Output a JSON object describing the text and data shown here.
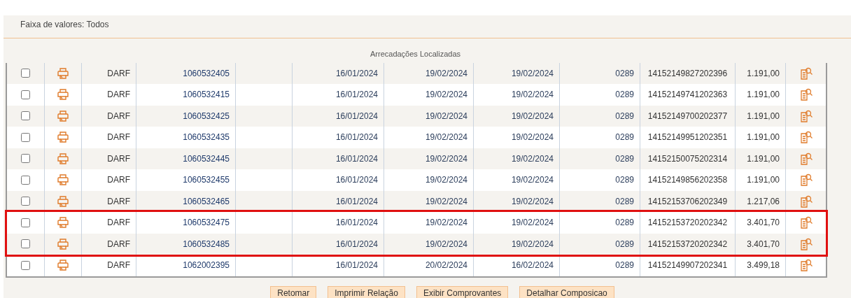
{
  "filter_summary": "Faixa de valores: Todos",
  "table": {
    "title": "Arrecadações Localizadas",
    "rows": [
      {
        "checked": false,
        "highlighted": false,
        "type": "DARF",
        "number": "1060532405",
        "date_1": "16/01/2024",
        "date_2": "19/02/2024",
        "date_3": "19/02/2024",
        "code": "0289",
        "reference": "14152149827202396",
        "amount": "1.191,00"
      },
      {
        "checked": false,
        "highlighted": false,
        "type": "DARF",
        "number": "1060532415",
        "date_1": "16/01/2024",
        "date_2": "19/02/2024",
        "date_3": "19/02/2024",
        "code": "0289",
        "reference": "14152149741202363",
        "amount": "1.191,00"
      },
      {
        "checked": false,
        "highlighted": false,
        "type": "DARF",
        "number": "1060532425",
        "date_1": "16/01/2024",
        "date_2": "19/02/2024",
        "date_3": "19/02/2024",
        "code": "0289",
        "reference": "14152149700202377",
        "amount": "1.191,00"
      },
      {
        "checked": false,
        "highlighted": false,
        "type": "DARF",
        "number": "1060532435",
        "date_1": "16/01/2024",
        "date_2": "19/02/2024",
        "date_3": "19/02/2024",
        "code": "0289",
        "reference": "14152149951202351",
        "amount": "1.191,00"
      },
      {
        "checked": false,
        "highlighted": false,
        "type": "DARF",
        "number": "1060532445",
        "date_1": "16/01/2024",
        "date_2": "19/02/2024",
        "date_3": "19/02/2024",
        "code": "0289",
        "reference": "14152150075202314",
        "amount": "1.191,00"
      },
      {
        "checked": false,
        "highlighted": false,
        "type": "DARF",
        "number": "1060532455",
        "date_1": "16/01/2024",
        "date_2": "19/02/2024",
        "date_3": "19/02/2024",
        "code": "0289",
        "reference": "14152149856202358",
        "amount": "1.191,00"
      },
      {
        "checked": false,
        "highlighted": false,
        "type": "DARF",
        "number": "1060532465",
        "date_1": "16/01/2024",
        "date_2": "19/02/2024",
        "date_3": "19/02/2024",
        "code": "0289",
        "reference": "14152153706202349",
        "amount": "1.217,06"
      },
      {
        "checked": false,
        "highlighted": true,
        "type": "DARF",
        "number": "1060532475",
        "date_1": "16/01/2024",
        "date_2": "19/02/2024",
        "date_3": "19/02/2024",
        "code": "0289",
        "reference": "14152153720202342",
        "amount": "3.401,70"
      },
      {
        "checked": false,
        "highlighted": true,
        "type": "DARF",
        "number": "1060532485",
        "date_1": "16/01/2024",
        "date_2": "19/02/2024",
        "date_3": "19/02/2024",
        "code": "0289",
        "reference": "14152153720202342",
        "amount": "3.401,70"
      },
      {
        "checked": false,
        "highlighted": false,
        "type": "DARF",
        "number": "1062002395",
        "date_1": "16/01/2024",
        "date_2": "20/02/2024",
        "date_3": "16/02/2024",
        "code": "0289",
        "reference": "14152149907202341",
        "amount": "3.499,18"
      }
    ]
  },
  "buttons": [
    "Retomar",
    "Imprimir Relação",
    "Exibir Comprovantes",
    "Detalhar Composicao"
  ]
}
